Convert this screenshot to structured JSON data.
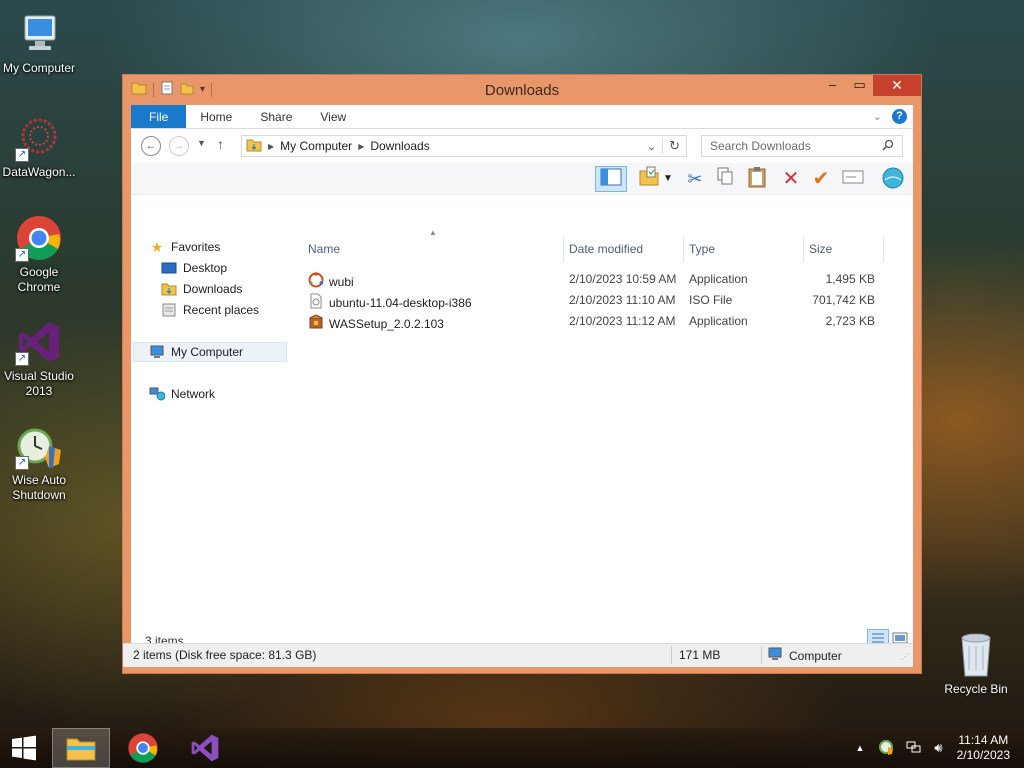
{
  "desktop": {
    "icons": [
      {
        "label": "My Computer",
        "icon": "computer-icon"
      },
      {
        "label": "DataWagon...",
        "icon": "datawagon-icon"
      },
      {
        "label": "Google Chrome",
        "icon": "chrome-icon"
      },
      {
        "label": "Visual Studio 2013",
        "icon": "visual-studio-icon"
      },
      {
        "label": "Wise Auto Shutdown",
        "icon": "wise-auto-shutdown-icon"
      }
    ],
    "recycle_bin": "Recycle Bin"
  },
  "window": {
    "title": "Downloads",
    "tabs": [
      "File",
      "Home",
      "Share",
      "View"
    ],
    "address": {
      "segments": [
        "My Computer",
        "Downloads"
      ]
    },
    "search_placeholder": "Search Downloads",
    "nav": {
      "favorites": "Favorites",
      "favorites_items": [
        "Desktop",
        "Downloads",
        "Recent places"
      ],
      "computer": "My Computer",
      "network": "Network"
    },
    "columns": [
      "Name",
      "Date modified",
      "Type",
      "Size"
    ],
    "files": [
      {
        "name": "wubi",
        "date": "2/10/2023 10:59 AM",
        "type": "Application",
        "size": "1,495 KB",
        "icon": "wubi-icon"
      },
      {
        "name": "ubuntu-11.04-desktop-i386",
        "date": "2/10/2023 11:10 AM",
        "type": "ISO File",
        "size": "701,742 KB",
        "icon": "iso-file-icon"
      },
      {
        "name": "WASSetup_2.0.2.103",
        "date": "2/10/2023 11:12 AM",
        "type": "Application",
        "size": "2,723 KB",
        "icon": "setup-icon"
      }
    ],
    "item_count": "3 items",
    "status": {
      "selection": "2 items (Disk free space: 81.3 GB)",
      "size": "171 MB",
      "location": "Computer"
    }
  },
  "taskbar": {
    "time": "11:14 AM",
    "date": "2/10/2023"
  },
  "colors": {
    "window_frame": "#e9966a",
    "close_button": "#c7402c",
    "file_tab": "#1979ca"
  }
}
